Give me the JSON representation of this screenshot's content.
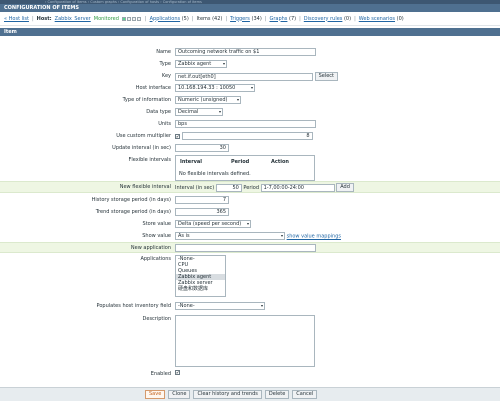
{
  "header": {
    "title": "CONFIGURATION OF ITEMS"
  },
  "hostbar": {
    "host_list": "« Host list",
    "host_label": "Host:",
    "host_name": "Zabbix_Server",
    "status": "Monitored",
    "links": [
      {
        "label": "Applications",
        "count": "(5)"
      },
      {
        "label": "Items",
        "count": "(42)"
      },
      {
        "label": "Triggers",
        "count": "(34)"
      },
      {
        "label": "Graphs",
        "count": "(7)"
      },
      {
        "label": "Discovery rules",
        "count": "(0)"
      },
      {
        "label": "Web scenarios",
        "count": "(0)"
      }
    ],
    "status_color": "#2f9a41"
  },
  "section": {
    "title": "Item"
  },
  "form": {
    "name": {
      "label": "Name",
      "value": "Outcoming network traffic on $1"
    },
    "type": {
      "label": "Type",
      "value": "Zabbix agent"
    },
    "key": {
      "label": "Key",
      "value": "net.if.out[eth0]",
      "button": "Select"
    },
    "host_interface": {
      "label": "Host interface",
      "value": "10.168.194.33 : 10050"
    },
    "type_of_information": {
      "label": "Type of information",
      "value": "Numeric (unsigned)"
    },
    "data_type": {
      "label": "Data type",
      "value": "Decimal"
    },
    "units": {
      "label": "Units",
      "value": "bps"
    },
    "custom_multiplier": {
      "label": "Use custom multiplier",
      "checked": "✔",
      "value": "8"
    },
    "update_interval": {
      "label": "Update interval (in sec)",
      "value": "30"
    },
    "flexible_intervals": {
      "label": "Flexible intervals",
      "columns": [
        "Interval",
        "Period",
        "Action"
      ],
      "empty_text": "No flexible intervals defined."
    },
    "new_flexible_interval": {
      "label": "New flexible interval",
      "interval_label": "Interval (in sec)",
      "interval_value": "50",
      "period_label": "Period",
      "period_value": "1-7,00:00-24:00",
      "button": "Add"
    },
    "history": {
      "label": "History storage period (in days)",
      "value": "7"
    },
    "trends": {
      "label": "Trend storage period (in days)",
      "value": "365"
    },
    "store_value": {
      "label": "Store value",
      "value": "Delta (speed per second)"
    },
    "show_value": {
      "label": "Show value",
      "value": "As is",
      "link": "show value mappings"
    },
    "new_application": {
      "label": "New application",
      "value": ""
    },
    "applications": {
      "label": "Applications",
      "options": [
        "-None-",
        "CPU",
        "Queues",
        "Zabbix agent",
        "Zabbix server",
        "硬盘和数据库"
      ],
      "selected": "Zabbix agent"
    },
    "inventory": {
      "label": "Populates host inventory field",
      "value": "-None-"
    },
    "description": {
      "label": "Description",
      "value": ""
    },
    "enabled": {
      "label": "Enabled",
      "checked": "✔"
    }
  },
  "footer": {
    "buttons": [
      "Save",
      "Clone",
      "Clear history and trends",
      "Delete",
      "Cancel"
    ]
  }
}
